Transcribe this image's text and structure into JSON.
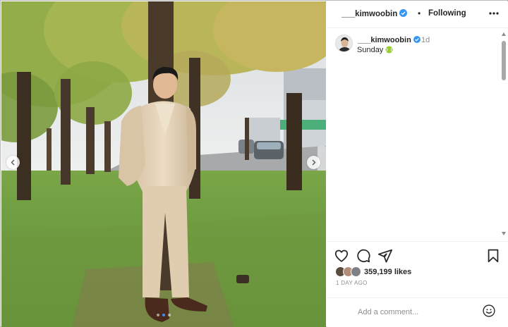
{
  "post": {
    "header": {
      "username": "___kimwoobin",
      "separator": "•",
      "follow_status": "Following"
    },
    "caption": {
      "username": "___kimwoobin",
      "time_ago": "1d",
      "text": "Sunday"
    },
    "likes_text": "359,199 likes",
    "posted_ago": "1 DAY AGO",
    "comment": {
      "placeholder": "Add a comment...",
      "value": ""
    },
    "carousel": {
      "slide_count": 3,
      "active_slide": 2
    }
  },
  "icons": {
    "verified": "verified-badge-icon",
    "more": "more-options-icon",
    "caption_emoji": "tennis-ball-icon",
    "like": "heart-icon",
    "comment": "comment-bubble-icon",
    "share": "paper-plane-icon",
    "save": "bookmark-icon",
    "emoji": "smiley-icon",
    "prev": "chevron-left-icon",
    "next": "chevron-right-icon"
  },
  "colors": {
    "verified": "#3897f0",
    "active_dot": "#3a8ef6",
    "text": "#262626",
    "muted": "#8e8e8e",
    "tennis_ball": "#9acd32"
  }
}
